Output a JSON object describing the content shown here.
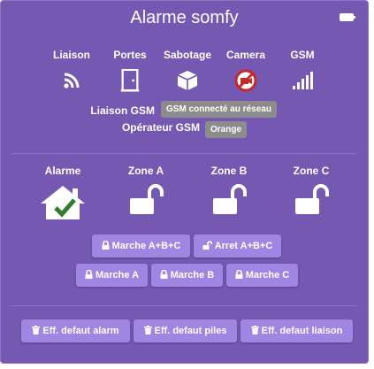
{
  "header": {
    "title": "Alarme somfy",
    "battery_icon": "battery-full-icon"
  },
  "status": {
    "items": [
      {
        "label": "Liaison",
        "icon": "rss-icon"
      },
      {
        "label": "Portes",
        "icon": "door-icon"
      },
      {
        "label": "Sabotage",
        "icon": "box-icon"
      },
      {
        "label": "Camera",
        "icon": "camera-off-icon"
      },
      {
        "label": "GSM",
        "icon": "signal-icon"
      }
    ],
    "liaison_gsm_label": "Liaison GSM",
    "liaison_gsm_value": "GSM connecté au réseau",
    "operateur_label": "Opérateur GSM",
    "operateur_value": "Orange"
  },
  "zones": {
    "items": [
      {
        "label": "Alarme",
        "icon": "home-check-icon"
      },
      {
        "label": "Zone A",
        "icon": "unlock-icon"
      },
      {
        "label": "Zone B",
        "icon": "unlock-icon"
      },
      {
        "label": "Zone C",
        "icon": "unlock-icon"
      }
    ]
  },
  "controls": {
    "marche_abc": "Marche A+B+C",
    "arret_abc": "Arret A+B+C",
    "marche_a": "Marche A",
    "marche_b": "Marche B",
    "marche_c": "Marche C"
  },
  "defaults": {
    "alarm": "Eff. defaut alarm",
    "piles": "Eff. defaut piles",
    "liaison": "Eff. defaut liaison"
  },
  "colors": {
    "card_background": "#7558b2",
    "button_background": "#9e86e2",
    "tag_background": "#8c8c8c",
    "check_green": "#2e7d32",
    "camera_red": "#c62828"
  }
}
